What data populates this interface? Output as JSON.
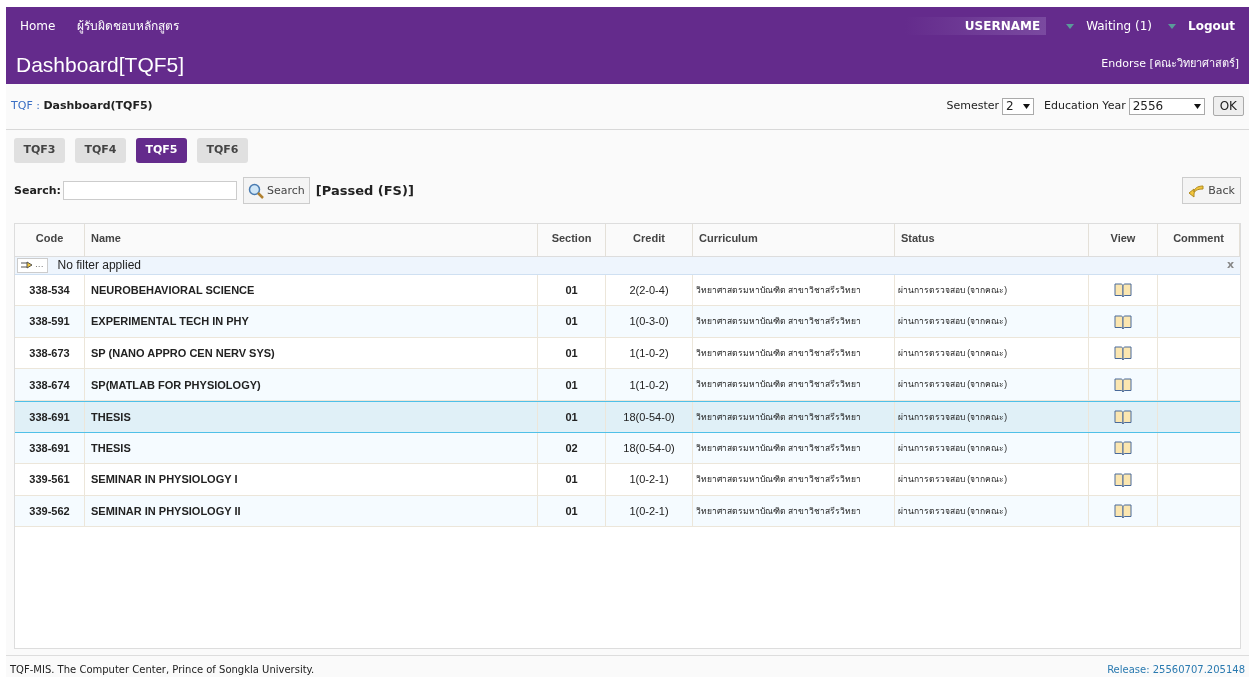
{
  "nav": {
    "links": [
      "Home",
      "ผู้รับผิดชอบหลักสูตร"
    ],
    "user": "USERNAME",
    "waiting": "Waiting (1)",
    "logout": "Logout"
  },
  "header": {
    "title": "Dashboard[TQF5]",
    "role": "Endorse [คณะวิทยาศาสตร์]"
  },
  "breadcrumb": {
    "root": "TQF",
    "separator": ":",
    "current": "Dashboard(TQF5)"
  },
  "period": {
    "semester_label": "Semester",
    "semester": "2",
    "year_label": "Education Year",
    "year": "2556",
    "ok": "OK"
  },
  "tabs": [
    {
      "label": "TQF3",
      "selected": false
    },
    {
      "label": "TQF4",
      "selected": false
    },
    {
      "label": "TQF5",
      "selected": true
    },
    {
      "label": "TQF6",
      "selected": false
    }
  ],
  "search": {
    "label": "Search:",
    "button": "Search",
    "filter_status": "[Passed (FS)]",
    "back": "Back"
  },
  "table": {
    "columns": [
      "Code",
      "Name",
      "Section",
      "Credit",
      "Curriculum",
      "Status",
      "View",
      "Comment"
    ],
    "filter_button": "...",
    "filter_text": "No filter applied",
    "filter_clear": "x",
    "rows": [
      {
        "code": "338-534",
        "name": "NEUROBEHAVIORAL SCIENCE",
        "section": "01",
        "credit": "2(2-0-4)",
        "curriculum": "วิทยาศาสตรมหาบัณฑิต สาขาวิชาสรีรวิทยา",
        "status": "ผ่านการตรวจสอบ (จากคณะ)",
        "selected": false
      },
      {
        "code": "338-591",
        "name": "EXPERIMENTAL TECH IN PHY",
        "section": "01",
        "credit": "1(0-3-0)",
        "curriculum": "วิทยาศาสตรมหาบัณฑิต สาขาวิชาสรีรวิทยา",
        "status": "ผ่านการตรวจสอบ (จากคณะ)",
        "selected": false
      },
      {
        "code": "338-673",
        "name": "SP (NANO APPRO CEN NERV SYS)",
        "section": "01",
        "credit": "1(1-0-2)",
        "curriculum": "วิทยาศาสตรมหาบัณฑิต สาขาวิชาสรีรวิทยา",
        "status": "ผ่านการตรวจสอบ (จากคณะ)",
        "selected": false
      },
      {
        "code": "338-674",
        "name": "SP(MATLAB FOR PHYSIOLOGY)",
        "section": "01",
        "credit": "1(1-0-2)",
        "curriculum": "วิทยาศาสตรมหาบัณฑิต สาขาวิชาสรีรวิทยา",
        "status": "ผ่านการตรวจสอบ (จากคณะ)",
        "selected": false
      },
      {
        "code": "338-691",
        "name": "THESIS",
        "section": "01",
        "credit": "18(0-54-0)",
        "curriculum": "วิทยาศาสตรมหาบัณฑิต สาขาวิชาสรีรวิทยา",
        "status": "ผ่านการตรวจสอบ (จากคณะ)",
        "selected": true
      },
      {
        "code": "338-691",
        "name": "THESIS",
        "section": "02",
        "credit": "18(0-54-0)",
        "curriculum": "วิทยาศาสตรมหาบัณฑิต สาขาวิชาสรีรวิทยา",
        "status": "ผ่านการตรวจสอบ (จากคณะ)",
        "selected": false
      },
      {
        "code": "339-561",
        "name": "SEMINAR IN PHYSIOLOGY I",
        "section": "01",
        "credit": "1(0-2-1)",
        "curriculum": "วิทยาศาสตรมหาบัณฑิต สาขาวิชาสรีรวิทยา",
        "status": "ผ่านการตรวจสอบ (จากคณะ)",
        "selected": false
      },
      {
        "code": "339-562",
        "name": "SEMINAR IN PHYSIOLOGY II",
        "section": "01",
        "credit": "1(0-2-1)",
        "curriculum": "วิทยาศาสตรมหาบัณฑิต สาขาวิชาสรีรวิทยา",
        "status": "ผ่านการตรวจสอบ (จากคณะ)",
        "selected": false
      }
    ]
  },
  "footer": {
    "credit": "TQF-MIS. The Computer Center, Prince of Songkla University.",
    "release": "Release: 25560707.205148"
  }
}
